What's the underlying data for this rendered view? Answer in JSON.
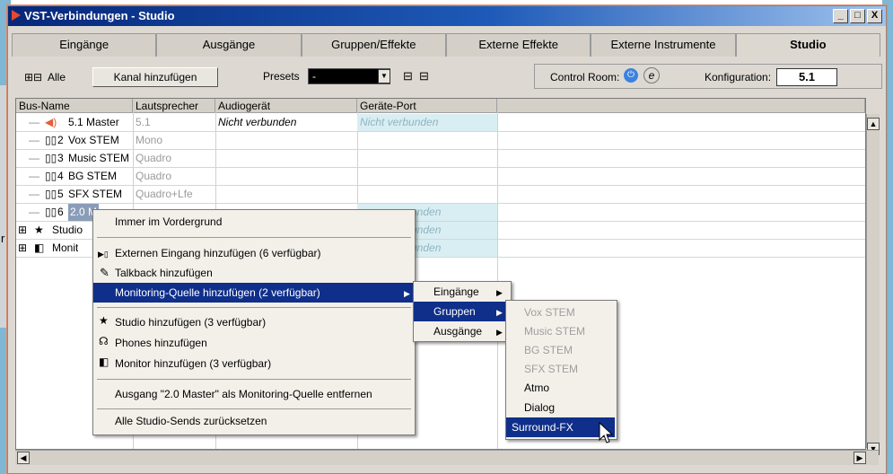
{
  "window": {
    "title": "VST-Verbindungen - Studio",
    "controls": [
      "_",
      "□",
      "X"
    ]
  },
  "tabs": [
    "Eingänge",
    "Ausgänge",
    "Gruppen/Effekte",
    "Externe Effekte",
    "Externe Instrumente",
    "Studio"
  ],
  "active_tab": "Studio",
  "toolbar": {
    "all_label": "Alle",
    "add_channel": "Kanal hinzufügen",
    "presets_label": "Presets",
    "presets_value": "-",
    "control_room_label": "Control Room:",
    "configuration_label": "Konfiguration:",
    "configuration_value": "5.1"
  },
  "columns": [
    "Bus-Name",
    "Lautsprecher",
    "Audiogerät",
    "Geräte-Port"
  ],
  "rows": [
    {
      "name": "5.1 Master",
      "speaker": "5.1",
      "device": "Nicht verbunden",
      "port": "Nicht verbunden"
    },
    {
      "name": "Vox STEM",
      "speaker": "Mono",
      "device": "",
      "port": ""
    },
    {
      "name": "Music STEM",
      "speaker": "Quadro",
      "device": "",
      "port": ""
    },
    {
      "name": "BG STEM",
      "speaker": "Quadro",
      "device": "",
      "port": ""
    },
    {
      "name": "SFX STEM",
      "speaker": "Quadro+Lfe",
      "device": "",
      "port": ""
    },
    {
      "name": "2.0 M",
      "speaker": "",
      "device": "",
      "port": "unden"
    },
    {
      "name": "Studio",
      "speaker": "",
      "device": "",
      "port": "unden"
    },
    {
      "name": "Monit",
      "speaker": "",
      "device": "",
      "port": "unden"
    }
  ],
  "row_numbers": [
    "2",
    "3",
    "4",
    "5",
    "6"
  ],
  "context_menu": {
    "items": [
      "Immer im Vordergrund",
      "Externen Eingang hinzufügen (6 verfügbar)",
      "Talkback hinzufügen",
      "Monitoring-Quelle hinzufügen (2 verfügbar)",
      "Studio hinzufügen (3 verfügbar)",
      "Phones hinzufügen",
      "Monitor hinzufügen (3 verfügbar)",
      "Ausgang \"2.0 Master\" als Monitoring-Quelle entfernen",
      "Alle Studio-Sends zurücksetzen"
    ]
  },
  "submenu1": [
    "Eingänge",
    "Gruppen",
    "Ausgänge"
  ],
  "submenu2": {
    "disabled": [
      "Vox STEM",
      "Music STEM",
      "BG STEM",
      "SFX STEM"
    ],
    "enabled": [
      "Atmo",
      "Dialog",
      "Surround-FX"
    ]
  },
  "background_char": "r",
  "colors": {
    "titlebar": "#06277a",
    "selection": "#0f2f8a",
    "port_bg": "#d9eef3"
  }
}
